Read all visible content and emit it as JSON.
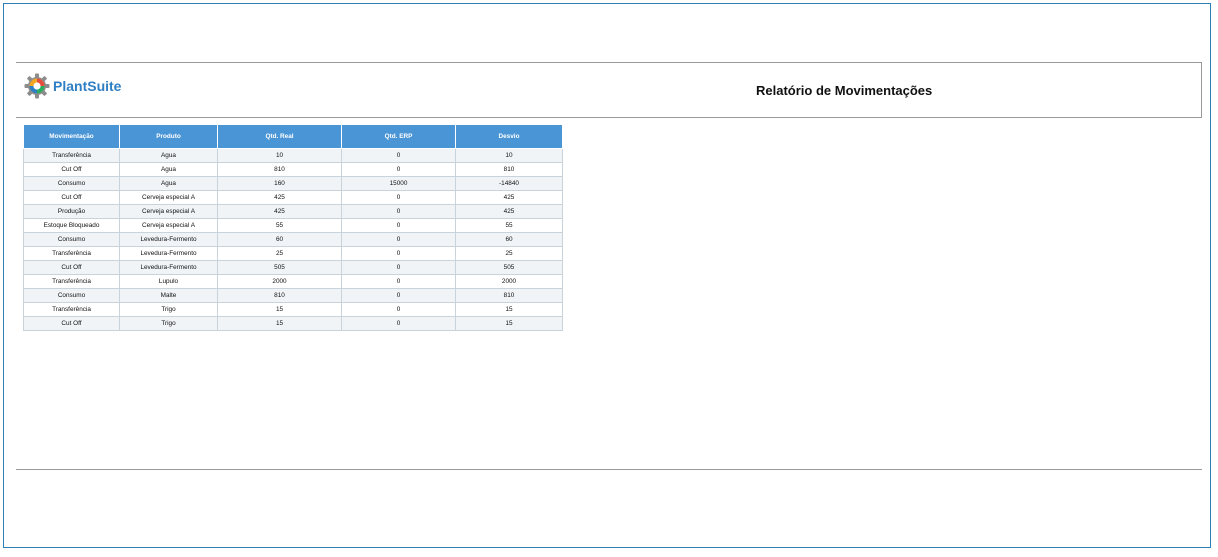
{
  "header": {
    "logo_text": "PlantSuite",
    "title": "Relatório de Movimentações"
  },
  "table": {
    "columns": [
      "Movimentação",
      "Produto",
      "Qtd. Real",
      "Qtd. ERP",
      "Desvio"
    ],
    "rows": [
      [
        "Transferência",
        "Agua",
        "10",
        "0",
        "10"
      ],
      [
        "Cut Off",
        "Agua",
        "810",
        "0",
        "810"
      ],
      [
        "Consumo",
        "Agua",
        "160",
        "15000",
        "-14840"
      ],
      [
        "Cut Off",
        "Cerveja especial A",
        "425",
        "0",
        "425"
      ],
      [
        "Produção",
        "Cerveja especial A",
        "425",
        "0",
        "425"
      ],
      [
        "Estoque Bloqueado",
        "Cerveja especial A",
        "55",
        "0",
        "55"
      ],
      [
        "Consumo",
        "Levedura-Fermento",
        "60",
        "0",
        "60"
      ],
      [
        "Transferência",
        "Levedura-Fermento",
        "25",
        "0",
        "25"
      ],
      [
        "Cut Off",
        "Levedura-Fermento",
        "505",
        "0",
        "505"
      ],
      [
        "Transferência",
        "Lupulo",
        "2000",
        "0",
        "2000"
      ],
      [
        "Consumo",
        "Malte",
        "810",
        "0",
        "810"
      ],
      [
        "Transferência",
        "Trigo",
        "15",
        "0",
        "15"
      ],
      [
        "Cut Off",
        "Trigo",
        "15",
        "0",
        "15"
      ]
    ]
  },
  "colors": {
    "frame_border": "#2f7fb5",
    "header_fill": "#4a95d6",
    "logo_blue": "#2e7fc3"
  }
}
